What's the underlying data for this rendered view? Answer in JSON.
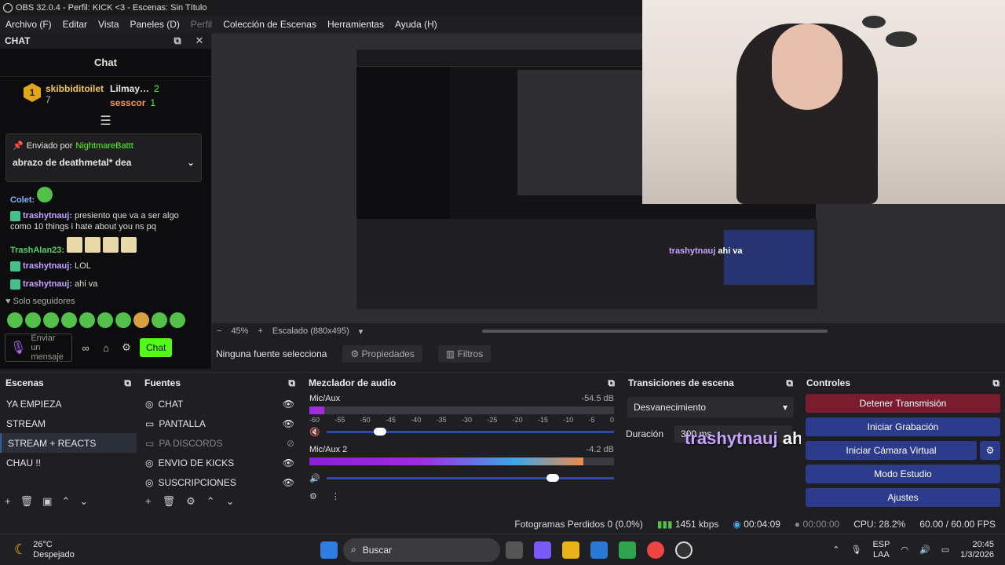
{
  "titlebar": {
    "text": "OBS 32.0.4 - Perfil: KICK <3 - Escenas: Sin Título"
  },
  "menu": {
    "items": [
      "Archivo (F)",
      "Editar",
      "Vista",
      "Paneles (D)",
      "Perfil",
      "Colección de Escenas",
      "Herramientas",
      "Ayuda (H)"
    ]
  },
  "chat": {
    "dock_title": "CHAT",
    "title": "Chat",
    "leaderboard": [
      {
        "name": "skibbiditoilet",
        "count": "7"
      },
      {
        "name": "Lilmay…",
        "count": "2"
      },
      {
        "name": "sesscor",
        "count": "1"
      }
    ],
    "pinned": {
      "by_prefix": "Enviado por",
      "by_user": "NightmareBattt",
      "text": "abrazo de deathmetal* dea"
    },
    "messages": [
      {
        "user": "Colet:",
        "text": ""
      },
      {
        "user": "trashytnauj:",
        "text": "presiento que va a ser algo como 10 things i hate about you ns pq"
      },
      {
        "user": "TrashAlan23:",
        "text": ""
      },
      {
        "user": "trashytnauj:",
        "text": "LOL"
      },
      {
        "user": "trashytnauj:",
        "text": "ahi va"
      }
    ],
    "followers_only": "Solo seguidores",
    "input_placeholder": "Enviar un mensaje",
    "send_label": "Chat"
  },
  "preview": {
    "zoom": "45%",
    "scale": "Escalado (880x495)",
    "no_source": "Ninguna fuente selecciona",
    "properties": "Propiedades",
    "filters": "Filtros"
  },
  "overlay": {
    "user": "trashytnauj",
    "text": "ahi va"
  },
  "scenes": {
    "title": "Escenas",
    "items": [
      "YA EMPIEZA",
      "STREAM",
      "STREAM + REACTS",
      "CHAU !!"
    ],
    "selected": 2
  },
  "sources": {
    "title": "Fuentes",
    "items": [
      "CHAT",
      "PANTALLA",
      "PA DISCORDS",
      "ENVIO DE KICKS",
      "SUSCRIPCIONES"
    ]
  },
  "mixer": {
    "title": "Mezclador de audio",
    "channels": [
      {
        "name": "Mic/Aux",
        "db": "-54.5 dB",
        "level": 0.05
      },
      {
        "name": "Mic/Aux 2",
        "db": "-4.2 dB",
        "level": 0.9
      }
    ],
    "ticks": [
      "-60",
      "-55",
      "-50",
      "-45",
      "-40",
      "-35",
      "-30",
      "-25",
      "-20",
      "-15",
      "-10",
      "-5",
      "0"
    ]
  },
  "transitions": {
    "title": "Transiciones de escena",
    "selected": "Desvanecimiento",
    "duration_label": "Duración",
    "duration": "300 ms"
  },
  "controls": {
    "title": "Controles",
    "buttons": [
      "Detener Transmisión",
      "Iniciar Grabación",
      "Iniciar Cámara Virtual",
      "Modo Estudio",
      "Ajustes"
    ]
  },
  "status": {
    "dropped": "Fotogramas Perdidos 0 (0.0%)",
    "bitrate": "1451 kbps",
    "stream_time": "00:04:09",
    "rec_time": "00:00:00",
    "cpu": "CPU: 28.2%",
    "fps": "60.00 / 60.00 FPS"
  },
  "taskbar": {
    "temp": "26°C",
    "weather": "Despejado",
    "search": "Buscar",
    "lang1": "ESP",
    "lang2": "LAA",
    "time": "20:45",
    "date": "1/3/2026"
  }
}
